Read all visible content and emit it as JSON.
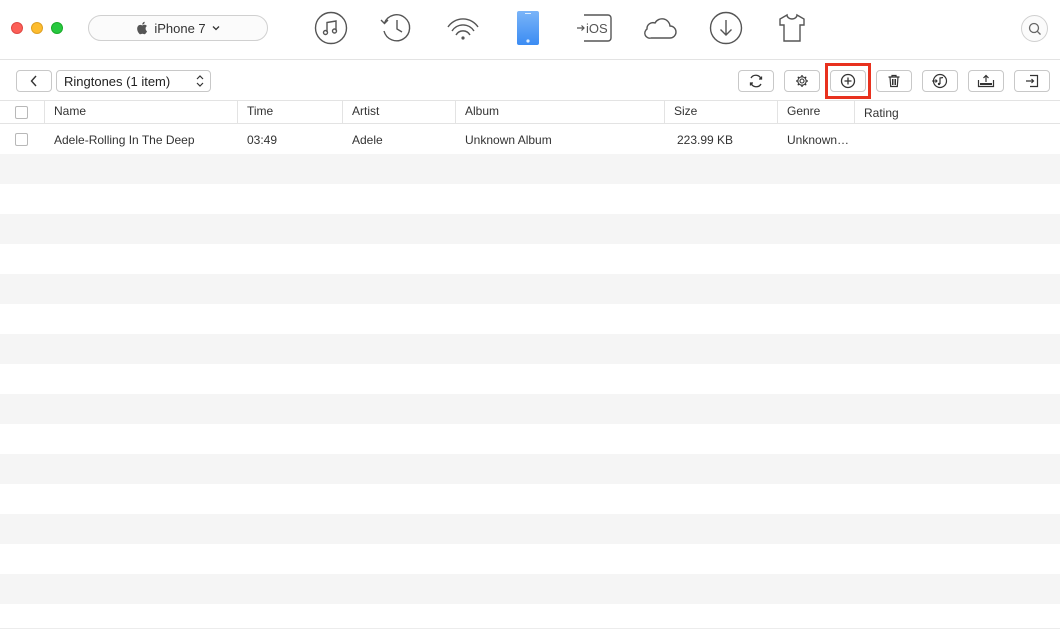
{
  "device": {
    "name": "iPhone 7"
  },
  "toolbar": {
    "category": "Ringtones (1 item)"
  },
  "table": {
    "columns": [
      "Name",
      "Time",
      "Artist",
      "Album",
      "Size",
      "Genre",
      "Rating"
    ],
    "rows": [
      {
        "name": "Adele-Rolling In The Deep",
        "time": "03:49",
        "artist": "Adele",
        "album": "Unknown Album",
        "size": "223.99 KB",
        "genre": "Unknown…",
        "rating": ""
      }
    ]
  },
  "colors": {
    "accent": "#3b8cf3",
    "highlight": "#e8311e",
    "row_alt": "#f5f5f5"
  }
}
